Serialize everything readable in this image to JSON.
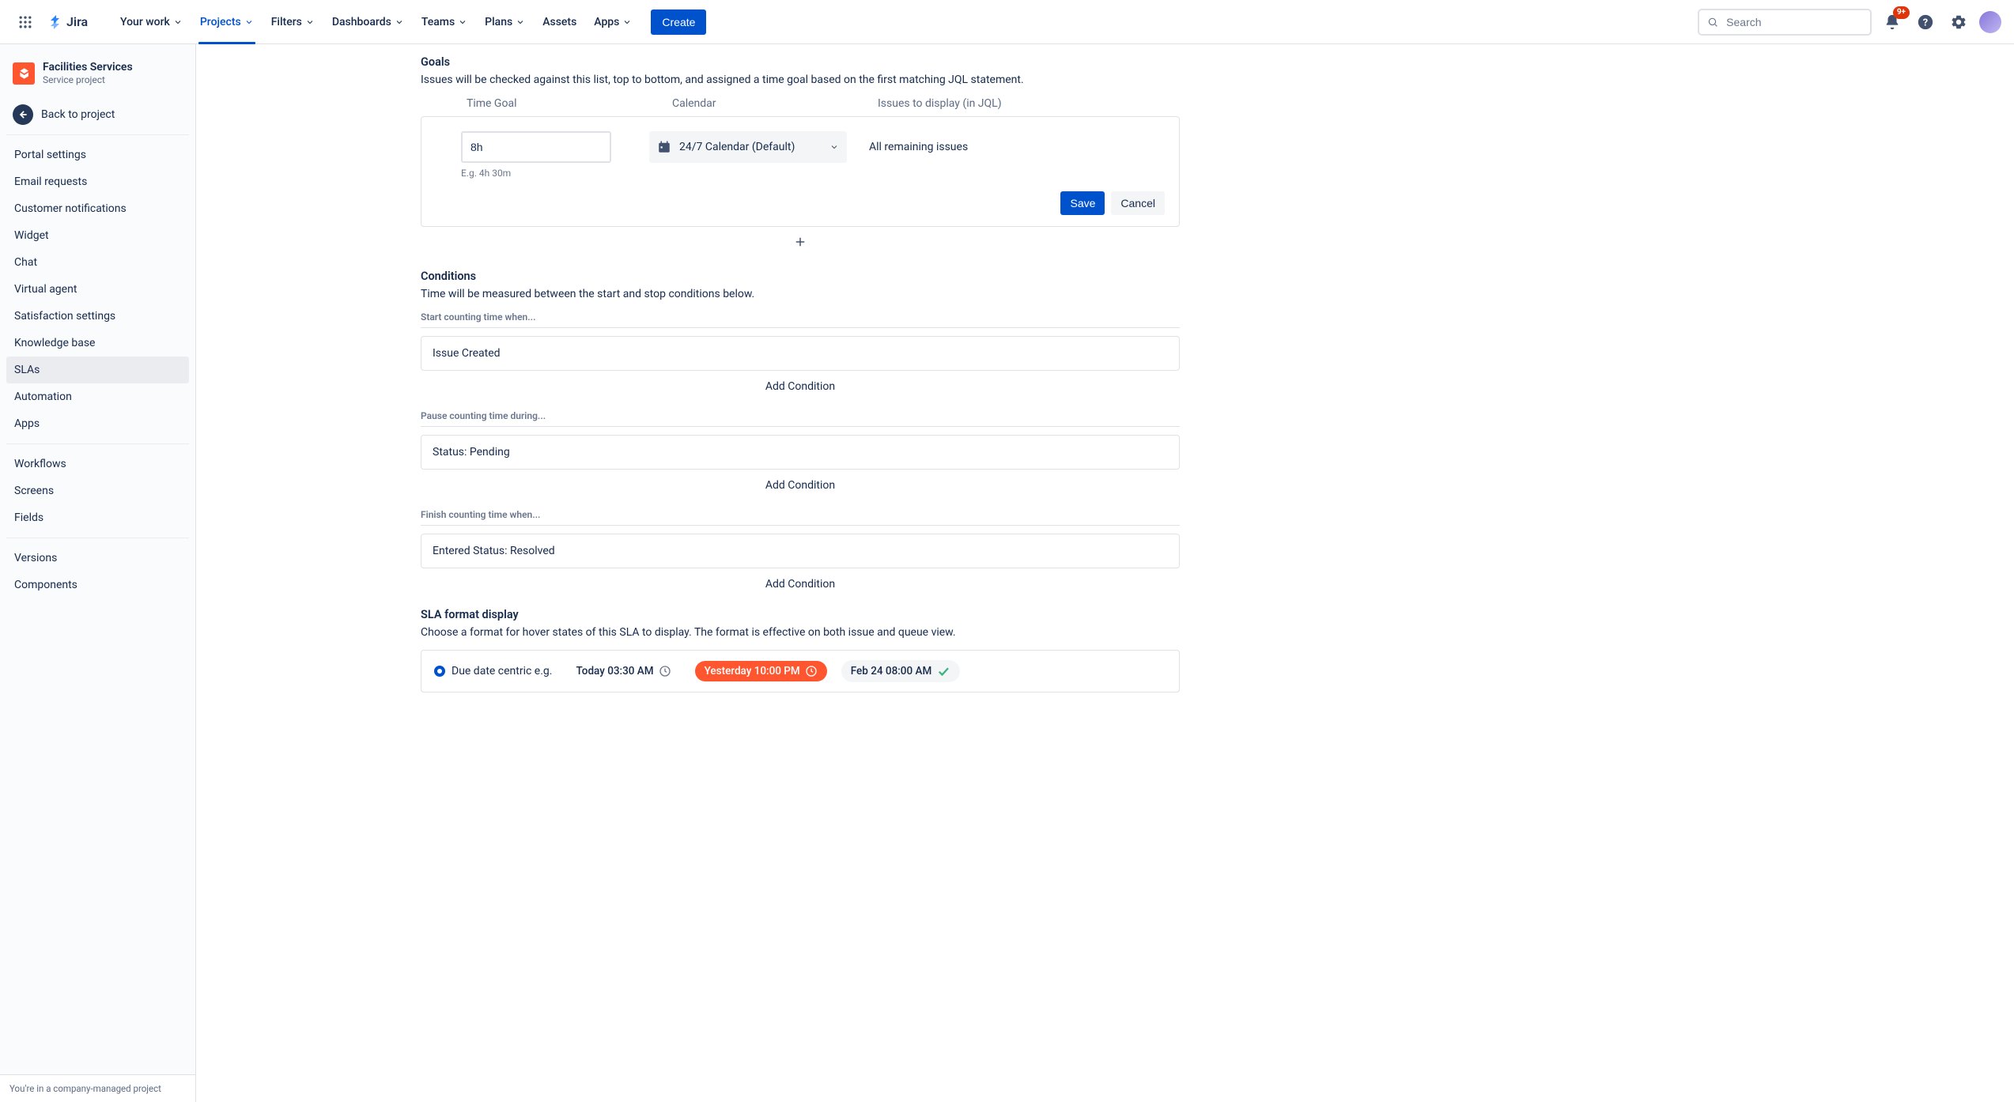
{
  "topnav": {
    "items": [
      {
        "label": "Your work",
        "active": false
      },
      {
        "label": "Projects",
        "active": true
      },
      {
        "label": "Filters",
        "active": false
      },
      {
        "label": "Dashboards",
        "active": false
      },
      {
        "label": "Teams",
        "active": false
      },
      {
        "label": "Plans",
        "active": false
      },
      {
        "label": "Assets",
        "active": false,
        "no_caret": true
      },
      {
        "label": "Apps",
        "active": false
      }
    ],
    "create_label": "Create",
    "search_placeholder": "Search",
    "notifications_badge": "9+"
  },
  "sidebar": {
    "project_name": "Facilities Services",
    "project_type": "Service project",
    "back_label": "Back to project",
    "groups": [
      [
        "Portal settings",
        "Email requests",
        "Customer notifications",
        "Widget",
        "Chat",
        "Virtual agent",
        "Satisfaction settings",
        "Knowledge base",
        "SLAs",
        "Automation",
        "Apps"
      ],
      [
        "Workflows",
        "Screens",
        "Fields"
      ],
      [
        "Versions",
        "Components"
      ]
    ],
    "selected": "SLAs",
    "footer": "You're in a company-managed project"
  },
  "goals": {
    "title": "Goals",
    "desc": "Issues will be checked against this list, top to bottom, and assigned a time goal based on the first matching JQL statement.",
    "headers": [
      "Time Goal",
      "Calendar",
      "Issues to display (in JQL)"
    ],
    "time_goal_value": "8h",
    "time_goal_hint": "E.g. 4h 30m",
    "calendar_value": "24/7 Calendar (Default)",
    "jql_value": "All remaining issues",
    "save_label": "Save",
    "cancel_label": "Cancel"
  },
  "conditions": {
    "title": "Conditions",
    "desc": "Time will be measured between the start and stop conditions below.",
    "start_label": "Start counting time when...",
    "start_value": "Issue Created",
    "pause_label": "Pause counting time during...",
    "pause_value": "Status: Pending",
    "finish_label": "Finish counting time when...",
    "finish_value": "Entered Status: Resolved",
    "add_label": "Add Condition"
  },
  "format": {
    "title": "SLA format display",
    "desc": "Choose a format for hover states of this SLA to display. The format is effective on both issue and queue view.",
    "option_label": "Due date centric e.g.",
    "pill_today": "Today 03:30 AM",
    "pill_yesterday": "Yesterday 10:00 PM",
    "pill_feb": "Feb 24 08:00 AM"
  }
}
